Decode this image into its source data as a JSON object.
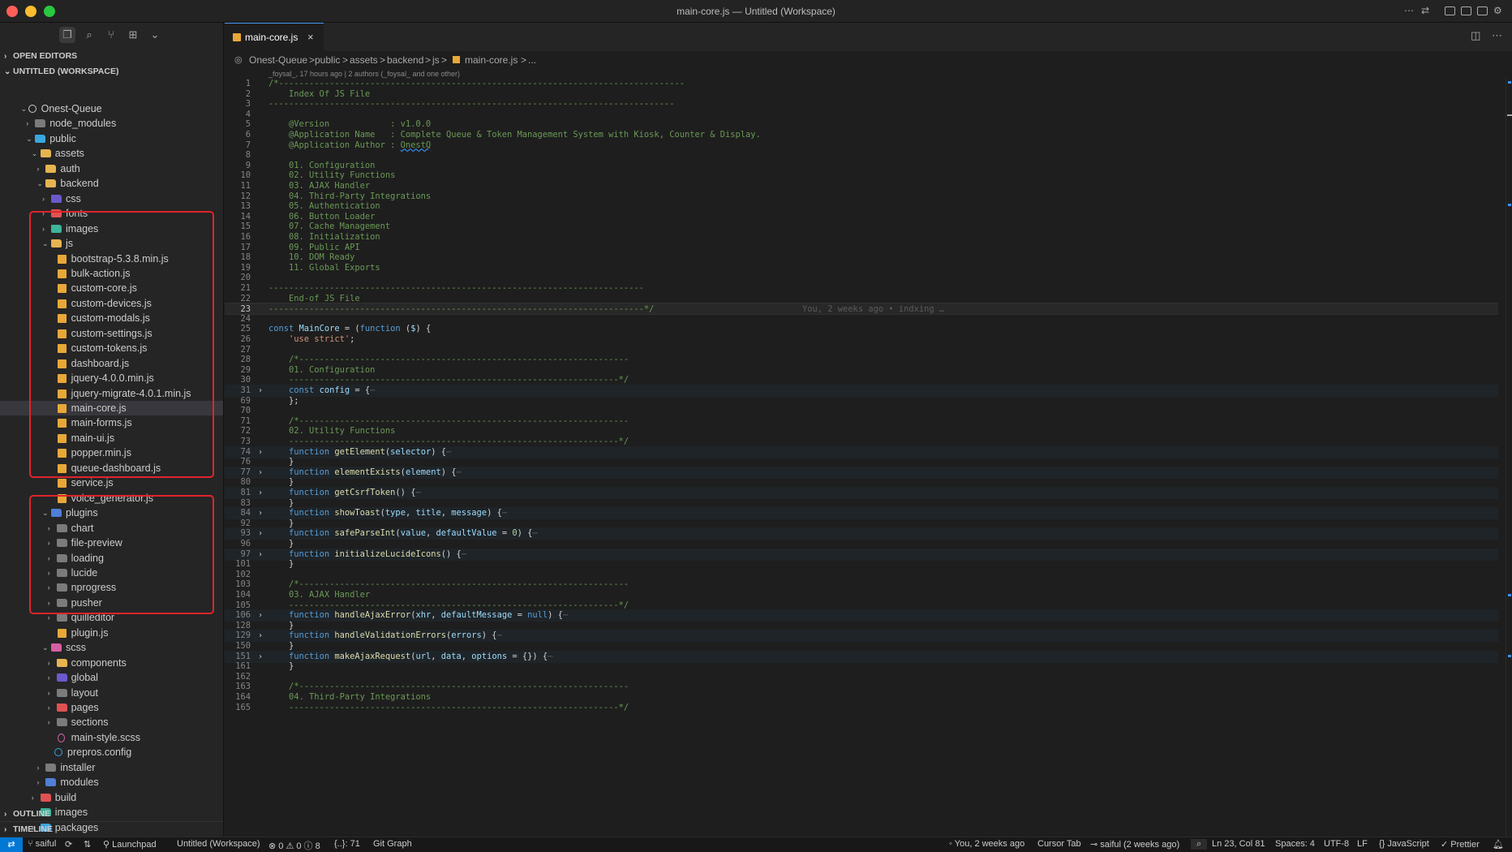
{
  "window": {
    "title": "main-core.js — Untitled (Workspace)"
  },
  "sidebar": {
    "sections": {
      "open_editors": "OPEN EDITORS",
      "workspace": "UNTITLED (WORKSPACE)",
      "outline": "OUTLINE",
      "timeline": "TIMELINE"
    },
    "tree": [
      {
        "label": "Onest-Queue",
        "kind": "root"
      },
      {
        "label": "node_modules",
        "kind": "folder"
      },
      {
        "label": "public",
        "kind": "folder"
      },
      {
        "label": "assets",
        "kind": "folder"
      },
      {
        "label": "auth",
        "kind": "folder"
      },
      {
        "label": "backend",
        "kind": "folder"
      },
      {
        "label": "css",
        "kind": "folder"
      },
      {
        "label": "fonts",
        "kind": "folder"
      },
      {
        "label": "images",
        "kind": "folder"
      },
      {
        "label": "js",
        "kind": "folder"
      },
      {
        "label": "bootstrap-5.3.8.min.js",
        "kind": "js"
      },
      {
        "label": "bulk-action.js",
        "kind": "js"
      },
      {
        "label": "custom-core.js",
        "kind": "js"
      },
      {
        "label": "custom-devices.js",
        "kind": "js"
      },
      {
        "label": "custom-modals.js",
        "kind": "js"
      },
      {
        "label": "custom-settings.js",
        "kind": "js"
      },
      {
        "label": "custom-tokens.js",
        "kind": "js"
      },
      {
        "label": "dashboard.js",
        "kind": "js"
      },
      {
        "label": "jquery-4.0.0.min.js",
        "kind": "js"
      },
      {
        "label": "jquery-migrate-4.0.1.min.js",
        "kind": "js"
      },
      {
        "label": "main-core.js",
        "kind": "js",
        "selected": true
      },
      {
        "label": "main-forms.js",
        "kind": "js"
      },
      {
        "label": "main-ui.js",
        "kind": "js"
      },
      {
        "label": "popper.min.js",
        "kind": "js"
      },
      {
        "label": "queue-dashboard.js",
        "kind": "js"
      },
      {
        "label": "service.js",
        "kind": "js"
      },
      {
        "label": "voice_generator.js",
        "kind": "js"
      },
      {
        "label": "plugins",
        "kind": "folder"
      },
      {
        "label": "chart",
        "kind": "folder"
      },
      {
        "label": "file-preview",
        "kind": "folder"
      },
      {
        "label": "loading",
        "kind": "folder"
      },
      {
        "label": "lucide",
        "kind": "folder"
      },
      {
        "label": "nprogress",
        "kind": "folder"
      },
      {
        "label": "pusher",
        "kind": "folder"
      },
      {
        "label": "quilleditor",
        "kind": "folder"
      },
      {
        "label": "plugin.js",
        "kind": "js"
      },
      {
        "label": "scss",
        "kind": "folder"
      },
      {
        "label": "components",
        "kind": "folder"
      },
      {
        "label": "global",
        "kind": "folder"
      },
      {
        "label": "layout",
        "kind": "folder"
      },
      {
        "label": "pages",
        "kind": "folder"
      },
      {
        "label": "sections",
        "kind": "folder"
      },
      {
        "label": "main-style.scss",
        "kind": "scss"
      },
      {
        "label": "prepros.config",
        "kind": "config"
      },
      {
        "label": "installer",
        "kind": "folder"
      },
      {
        "label": "modules",
        "kind": "folder"
      },
      {
        "label": "build",
        "kind": "folder"
      },
      {
        "label": "images",
        "kind": "folder"
      },
      {
        "label": "packages",
        "kind": "folder"
      }
    ]
  },
  "editor": {
    "tab_label": "main-core.js",
    "breadcrumb": [
      "Onest-Queue",
      ">",
      "public",
      ">",
      "assets",
      ">",
      "backend",
      ">",
      "js",
      ">",
      "main-core.js",
      ">",
      "..."
    ],
    "blame": "_foysal_, 17 hours ago | 2 authors (_foysal_ and one other)",
    "inline_blame": "You, 2 weeks ago • indxing …",
    "lines": [
      {
        "n": "1",
        "t": "/*--------------------------------------------------------------------------------"
      },
      {
        "n": "2",
        "t": "    Index Of JS File"
      },
      {
        "n": "3",
        "t": "--------------------------------------------------------------------------------"
      },
      {
        "n": "4",
        "t": ""
      },
      {
        "n": "5",
        "t": "    @Version            : v1.0.0"
      },
      {
        "n": "6",
        "t": "    @Application Name   : Complete Queue & Token Management System with Kiosk, Counter & Display."
      },
      {
        "n": "7",
        "t": "    @Application Author : OnestQ"
      },
      {
        "n": "8",
        "t": ""
      },
      {
        "n": "9",
        "t": "    01. Configuration"
      },
      {
        "n": "10",
        "t": "    02. Utility Functions"
      },
      {
        "n": "11",
        "t": "    03. AJAX Handler"
      },
      {
        "n": "12",
        "t": "    04. Third-Party Integrations"
      },
      {
        "n": "13",
        "t": "    05. Authentication"
      },
      {
        "n": "14",
        "t": "    06. Button Loader"
      },
      {
        "n": "15",
        "t": "    07. Cache Management"
      },
      {
        "n": "16",
        "t": "    08. Initialization"
      },
      {
        "n": "17",
        "t": "    09. Public API"
      },
      {
        "n": "18",
        "t": "    10. DOM Ready"
      },
      {
        "n": "19",
        "t": "    11. Global Exports"
      },
      {
        "n": "20",
        "t": ""
      },
      {
        "n": "21",
        "t": "--------------------------------------------------------------------------"
      },
      {
        "n": "22",
        "t": "    End-of JS File"
      },
      {
        "n": "23",
        "t": "--------------------------------------------------------------------------*/"
      },
      {
        "n": "24",
        "t": ""
      },
      {
        "n": "25",
        "t": "const MainCore = (function ($) {"
      },
      {
        "n": "26",
        "t": "    'use strict';"
      },
      {
        "n": "27",
        "t": ""
      },
      {
        "n": "28",
        "t": "    /*-----------------------------------------------------------------"
      },
      {
        "n": "29",
        "t": "    01. Configuration"
      },
      {
        "n": "30",
        "t": "    -----------------------------------------------------------------*/"
      },
      {
        "n": "31",
        "t": "    const config = {⋯"
      },
      {
        "n": "69",
        "t": "    };"
      },
      {
        "n": "70",
        "t": ""
      },
      {
        "n": "71",
        "t": "    /*-----------------------------------------------------------------"
      },
      {
        "n": "72",
        "t": "    02. Utility Functions"
      },
      {
        "n": "73",
        "t": "    -----------------------------------------------------------------*/"
      },
      {
        "n": "74",
        "t": "    function getElement(selector) {⋯"
      },
      {
        "n": "76",
        "t": "    }"
      },
      {
        "n": "77",
        "t": "    function elementExists(element) {⋯"
      },
      {
        "n": "80",
        "t": "    }"
      },
      {
        "n": "81",
        "t": "    function getCsrfToken() {⋯"
      },
      {
        "n": "83",
        "t": "    }"
      },
      {
        "n": "84",
        "t": "    function showToast(type, title, message) {⋯"
      },
      {
        "n": "92",
        "t": "    }"
      },
      {
        "n": "93",
        "t": "    function safeParseInt(value, defaultValue = 0) {⋯"
      },
      {
        "n": "96",
        "t": "    }"
      },
      {
        "n": "97",
        "t": "    function initializeLucideIcons() {⋯"
      },
      {
        "n": "101",
        "t": "    }"
      },
      {
        "n": "102",
        "t": ""
      },
      {
        "n": "103",
        "t": "    /*-----------------------------------------------------------------"
      },
      {
        "n": "104",
        "t": "    03. AJAX Handler"
      },
      {
        "n": "105",
        "t": "    -----------------------------------------------------------------*/"
      },
      {
        "n": "106",
        "t": "    function handleAjaxError(xhr, defaultMessage = null) {⋯"
      },
      {
        "n": "128",
        "t": "    }"
      },
      {
        "n": "129",
        "t": "    function handleValidationErrors(errors) {⋯"
      },
      {
        "n": "150",
        "t": "    }"
      },
      {
        "n": "151",
        "t": "    function makeAjaxRequest(url, data, options = {}) {⋯"
      },
      {
        "n": "161",
        "t": "    }"
      },
      {
        "n": "162",
        "t": ""
      },
      {
        "n": "163",
        "t": "    /*-----------------------------------------------------------------"
      },
      {
        "n": "164",
        "t": "    04. Third-Party Integrations"
      },
      {
        "n": "165",
        "t": "    -----------------------------------------------------------------*/"
      }
    ]
  },
  "statusbar": {
    "branch": "saiful",
    "launchpad": "Launchpad",
    "workspace": "Untitled (Workspace)",
    "problems": "⊗ 0 ⚠ 0 ⓘ 8",
    "symbols": "{..}: 71",
    "git_graph": "Git Graph",
    "blame": "You, 2 weeks ago",
    "cursor_tab": "Cursor Tab",
    "author": "saiful (2 weeks ago)",
    "position": "Ln 23, Col 81",
    "spaces": "Spaces: 4",
    "encoding": "UTF-8",
    "eol": "LF",
    "language": "JavaScript",
    "formatter": "Prettier"
  },
  "colors": {
    "accent": "#0078d4",
    "highlight_box": "#e0242b",
    "js_icon": "#e8a838"
  }
}
